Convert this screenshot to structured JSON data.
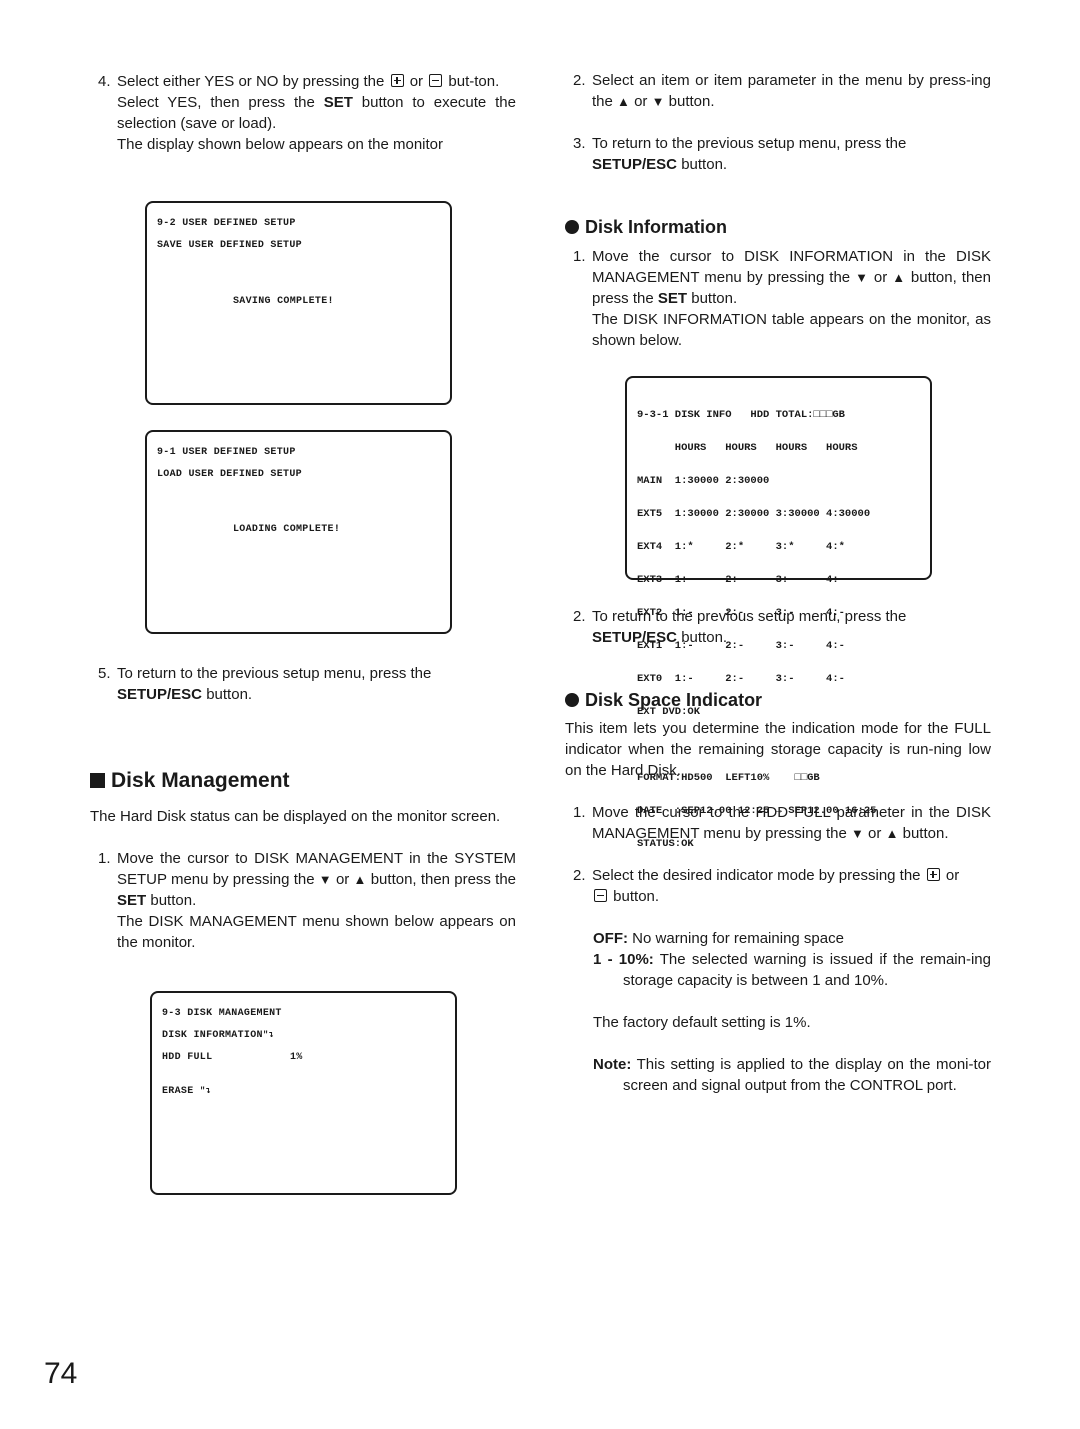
{
  "page_number": "74",
  "left": {
    "step4": {
      "num": "4.",
      "line1_pre": "Select either YES or NO by pressing the",
      "or": "or",
      "line1_post": "but-ton.",
      "line2_pre": "Select YES, then press the",
      "line2_bold": "SET",
      "line2_post": "button to execute the selection (save or load).",
      "line3": "The display shown below appears on the monitor"
    },
    "screen_save": {
      "line1": "9-2 USER DEFINED SETUP",
      "line2": "SAVE USER DEFINED SETUP",
      "line3": "SAVING COMPLETE!"
    },
    "screen_load": {
      "line1": "9-1 USER DEFINED SETUP",
      "line2": "LOAD USER DEFINED SETUP",
      "line3": "LOADING COMPLETE!"
    },
    "step5": {
      "num": "5.",
      "text": "To return to the previous setup menu, press the",
      "bold": "SETUP/ESC",
      "post": "button."
    },
    "section": {
      "title": "Disk Management",
      "intro": "The Hard Disk status can be displayed on the monitor screen.",
      "step1": {
        "num": "1.",
        "pre": "Move the cursor to DISK MANAGEMENT in the SYSTEM SETUP menu by pressing the",
        "down": "▼",
        "or": "or",
        "up": "▲",
        "mid": "button, then press the",
        "bold": "SET",
        "post": "button.",
        "line2": "The DISK MANAGEMENT menu shown below appears on the monitor."
      }
    },
    "screen_disk_mgmt": {
      "line1": "9-3 DISK MANAGEMENT",
      "line2": "DISK INFORMATION",
      "line2_icon": "\"↴",
      "line3_label": "HDD FULL",
      "line3_value": "1%",
      "line4": "ERASE",
      "line4_icon": "\"↴"
    }
  },
  "right": {
    "step2": {
      "num": "2.",
      "pre": "Select an item or item parameter in the menu by press-ing the",
      "up": "▲",
      "or": "or",
      "down": "▼",
      "post": "button."
    },
    "step3": {
      "num": "3.",
      "text": "To return to the previous setup menu, press the",
      "bold": "SETUP/ESC",
      "post": "button."
    },
    "disk_info": {
      "title": "Disk Information",
      "step1": {
        "num": "1.",
        "pre": "Move the cursor to DISK INFORMATION in the DISK MANAGEMENT menu by pressing the",
        "down": "▼",
        "or": "or",
        "up": "▲",
        "mid": "button, then press the",
        "bold": "SET",
        "post": "button.",
        "line2": "The DISK INFORMATION table appears on the monitor, as shown below."
      },
      "screen": {
        "rows": [
          "9-3-1 DISK INFO   HDD TOTAL:□□□GB",
          "      HOURS   HOURS   HOURS   HOURS",
          "MAIN  1:30000 2:30000",
          "EXT5  1:30000 2:30000 3:30000 4:30000",
          "EXT4  1:*     2:*     3:*     4:*",
          "EXT3  1:-     2:-     3:-     4:-",
          "EXT2  1:-     2:-     3:-     4:-",
          "EXT1  1:-     2:-     3:-     4:-",
          "EXT0  1:-     2:-     3:-     4:-",
          "EXT DVD:OK",
          "",
          "FORMAT:HD500  LEFT10%    □□GB",
          "DATE  :SEP12.00 12:25 → SEP12.00 16:25",
          "STATUS:OK"
        ]
      },
      "step2": {
        "num": "2.",
        "text": "To return to the previous setup menu, press the",
        "bold": "SETUP/ESC",
        "post": "button."
      }
    },
    "disk_space": {
      "title": "Disk Space Indicator",
      "intro": "This item lets you determine the indication mode for the FULL indicator when the remaining storage capacity is run-ning low on the Hard Disk.",
      "step1": {
        "num": "1.",
        "pre": "Move the cursor to the HDD FULL parameter in the DISK MANAGEMENT menu by pressing the",
        "down": "▼",
        "or": "or",
        "up": "▲",
        "post": "button."
      },
      "step2": {
        "num": "2.",
        "pre": "Select the desired indicator mode by pressing the",
        "or": "or",
        "post": "button."
      },
      "off_label": "OFF:",
      "off_text": "No warning for remaining space",
      "range_label": "1 - 10%:",
      "range_text": "The selected warning is issued if the remain-ing storage capacity is between 1 and 10%.",
      "default_text": "The factory default setting is 1%.",
      "note_label": "Note:",
      "note_text": "This setting is applied to the display on the moni-tor screen and signal output from the CONTROL port."
    }
  }
}
